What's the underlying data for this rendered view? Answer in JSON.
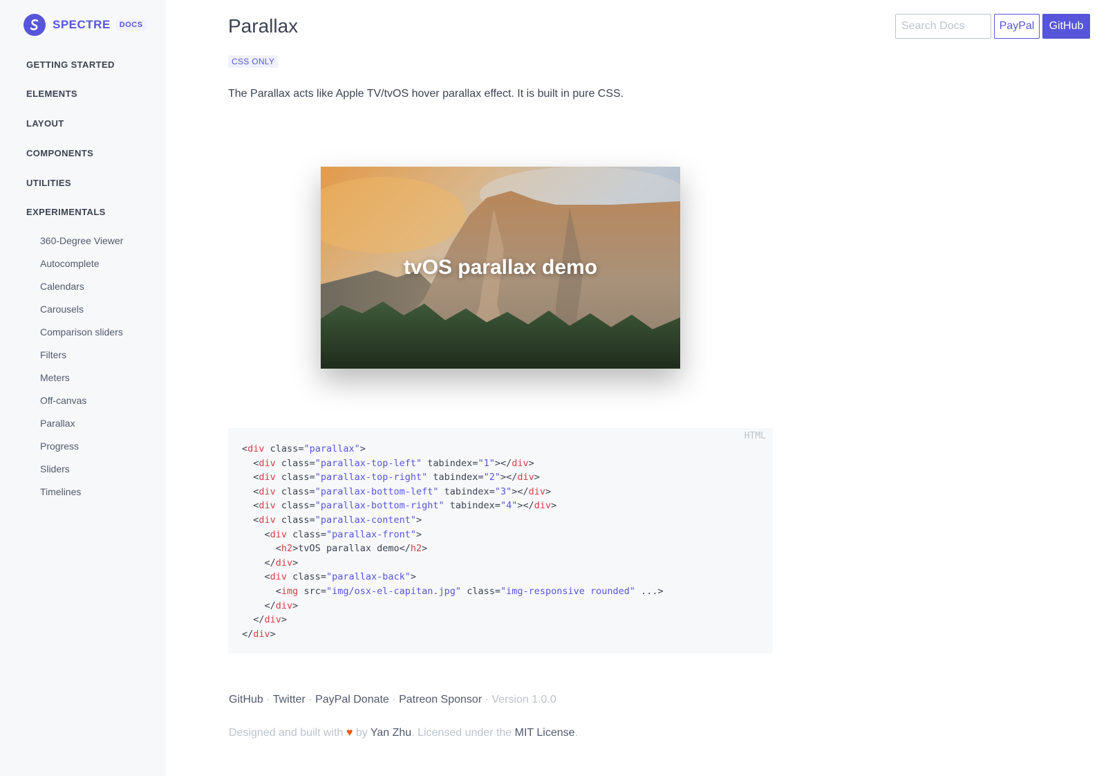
{
  "brand": {
    "name": "SPECTRE",
    "badge": "DOCS"
  },
  "nav": {
    "sections": [
      "GETTING STARTED",
      "ELEMENTS",
      "LAYOUT",
      "COMPONENTS",
      "UTILITIES",
      "EXPERIMENTALS"
    ],
    "experimentals": [
      "360-Degree Viewer",
      "Autocomplete",
      "Calendars",
      "Carousels",
      "Comparison sliders",
      "Filters",
      "Meters",
      "Off-canvas",
      "Parallax",
      "Progress",
      "Sliders",
      "Timelines"
    ]
  },
  "header": {
    "search_placeholder": "Search Docs",
    "paypal_label": "PayPal",
    "github_label": "GitHub"
  },
  "page": {
    "title": "Parallax",
    "label": "CSS ONLY",
    "description": "The Parallax acts like Apple TV/tvOS hover parallax effect. It is built in pure CSS.",
    "demo_text": "tvOS parallax demo"
  },
  "code": {
    "lang": "HTML",
    "lines": [
      "<div class=\"parallax\">",
      "  <div class=\"parallax-top-left\" tabindex=\"1\"></div>",
      "  <div class=\"parallax-top-right\" tabindex=\"2\"></div>",
      "  <div class=\"parallax-bottom-left\" tabindex=\"3\"></div>",
      "  <div class=\"parallax-bottom-right\" tabindex=\"4\"></div>",
      "  <div class=\"parallax-content\">",
      "    <div class=\"parallax-front\">",
      "      <h2>tvOS parallax demo</h2>",
      "    </div>",
      "    <div class=\"parallax-back\">",
      "      <img src=\"img/osx-el-capitan.jpg\" class=\"img-responsive rounded\" ...>",
      "    </div>",
      "  </div>",
      "</div>"
    ]
  },
  "footer": {
    "links": [
      "GitHub",
      "Twitter",
      "PayPal Donate",
      "Patreon Sponsor"
    ],
    "separator": "·",
    "version": "Version 1.0.0",
    "designed_prefix": "Designed and built with",
    "heart": "♥",
    "by": "by",
    "author": "Yan Zhu",
    "licensed": ". Licensed under the",
    "license": "MIT License",
    "period": "."
  },
  "colors": {
    "accent": "#5755d9",
    "code_tag": "#d73e48",
    "heart": "#e85600"
  }
}
